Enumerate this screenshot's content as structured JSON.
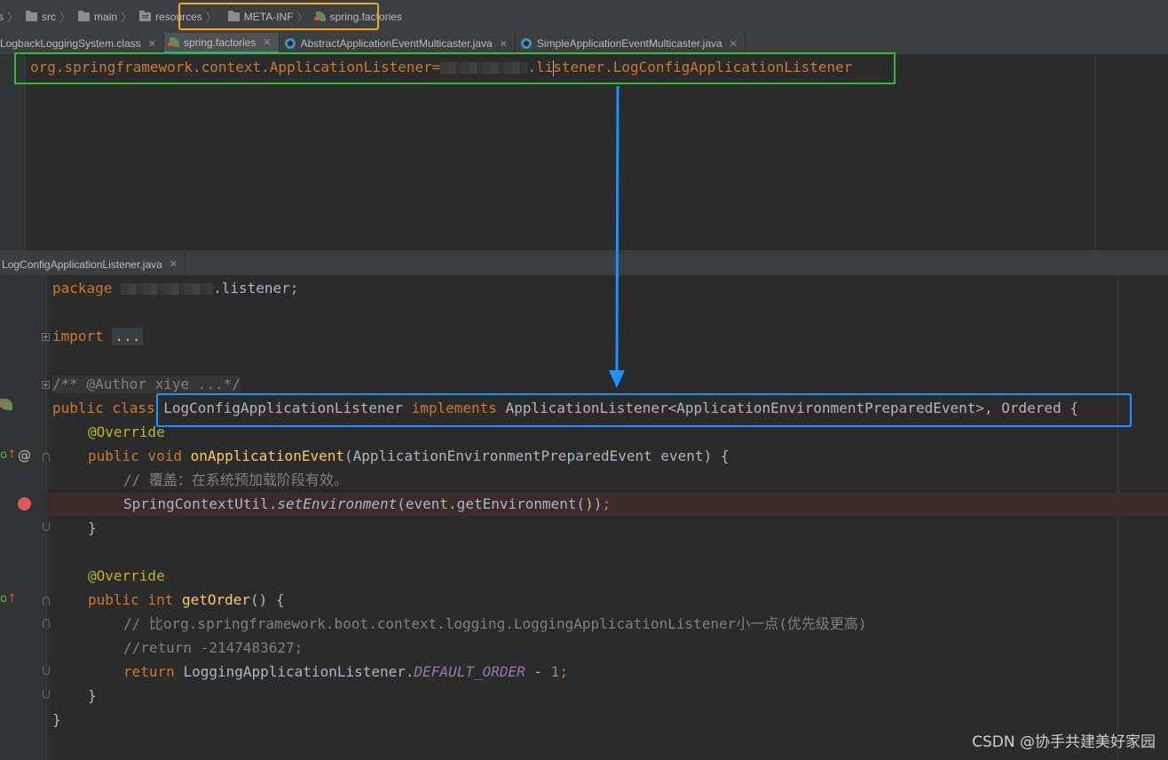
{
  "breadcrumb": {
    "items": [
      "s",
      "src",
      "main",
      "resources",
      "META-INF",
      "spring.factories"
    ]
  },
  "top_tabs": [
    {
      "label": "LogbackLoggingSystem.class",
      "active": false
    },
    {
      "label": "spring.factories",
      "active": true
    },
    {
      "label": "AbstractApplicationEventMulticaster.java",
      "active": false
    },
    {
      "label": "SimpleApplicationEventMulticaster.java",
      "active": false
    }
  ],
  "top_editor": {
    "key": "org.springframework.context.ApplicationListener=",
    "value_prefix": ".li",
    "value_suffix": "stener.LogConfigApplicationListener"
  },
  "bottom_tab": {
    "label": "LogConfigApplicationListener.java"
  },
  "code": {
    "l_package_kw": "package",
    "l_package_rest": ".listener;",
    "l_import_kw": "import",
    "l_import_fold": "...",
    "l_doc": "/** @Author xiye ...*/",
    "l_class_kw": "public class ",
    "l_class_name": "LogConfigApplicationListener ",
    "l_class_impl": "implements ",
    "l_class_rest": "ApplicationListener<ApplicationEnvironmentPreparedEvent>, Ordered {",
    "l_override1": "@Override",
    "l_method1_kw": "public void ",
    "l_method1_name": "onApplicationEvent",
    "l_method1_rest": "(ApplicationEnvironmentPreparedEvent event) {",
    "l_comment1": "// 覆盖：在系统预加载阶段有效。",
    "l_call_obj": "SpringContextUtil.",
    "l_call_fn": "setEnvironment",
    "l_call_rest": "(event.getEnvironment())",
    "l_call_end": ";",
    "l_close1": "}",
    "l_override2": "@Override",
    "l_method2_kw": "public int ",
    "l_method2_name": "getOrder",
    "l_method2_rest": "() {",
    "l_comment2": "// 比org.springframework.boot.context.logging.LoggingApplicationListener小一点(优先级更高)",
    "l_comment3": "//return -2147483627;",
    "l_return_kw": "return ",
    "l_return_obj": "LoggingApplicationListener.",
    "l_return_const": "DEFAULT_ORDER",
    "l_return_op": " - ",
    "l_return_num": "1",
    "l_return_end": ";",
    "l_close2": "}",
    "l_close3": "}"
  },
  "gutter": {
    "at_symbol": "@"
  },
  "watermark": "CSDN @协手共建美好家园",
  "colors": {
    "highlight_orange": "#f5a623",
    "highlight_green": "#2fbb2f",
    "highlight_blue": "#1e90ff",
    "arrow": "#1e90ff",
    "breakpoint": "#db5c5c"
  }
}
